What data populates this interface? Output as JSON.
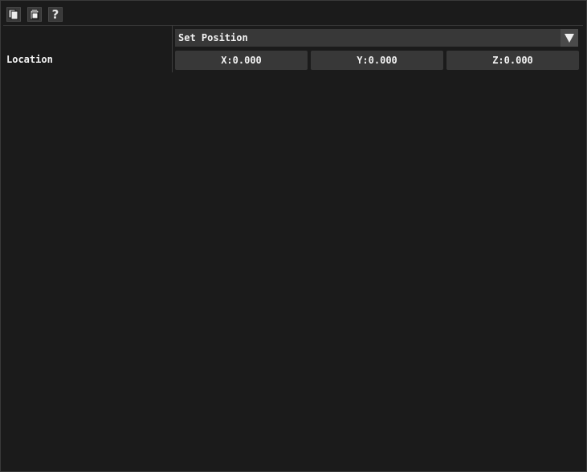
{
  "toolbar": {
    "buttons": [
      {
        "icon": "copy-icon"
      },
      {
        "icon": "paste-icon"
      },
      {
        "icon": "help-icon",
        "glyph": "?"
      }
    ]
  },
  "property": {
    "label": "Location",
    "mode": {
      "selected": "Set Position"
    },
    "fields": {
      "x": "X:0.000",
      "y": "Y:0.000",
      "z": "Z:0.000"
    }
  },
  "colors": {
    "background": "#1b1b1b",
    "field": "#383838",
    "text": "#f2f2f2"
  }
}
